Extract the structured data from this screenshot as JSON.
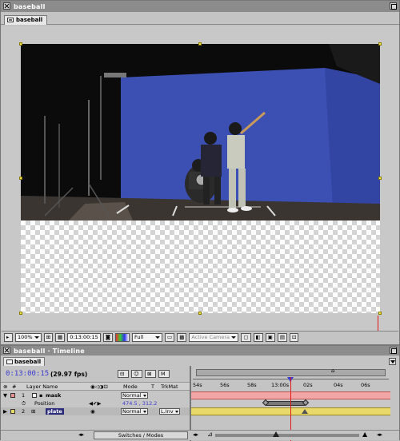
{
  "comp_window": {
    "title": "baseball",
    "tab_label": "baseball"
  },
  "comp_controls": {
    "zoom": "100%",
    "timecode": "0:13:00:15",
    "resolution": "Full",
    "view": "Active Camera"
  },
  "timeline_window": {
    "title": "baseball · Timeline",
    "tab_label": "baseball",
    "timecode": "0:13:00:15",
    "fps": "(29.97 fps)",
    "columns": {
      "layer_name": "Layer Name",
      "mode": "Mode",
      "t": "T",
      "trkmat": "TrkMat"
    },
    "layers": [
      {
        "number": "1",
        "name": "mask",
        "mode": "Normal",
        "color": "#e88e8e"
      },
      {
        "number": "2",
        "name": "plate",
        "mode": "Normal",
        "trkmat": "L.Inv",
        "color": "#e8d96a"
      }
    ],
    "position_property": {
      "label": "Position",
      "value": "474.5 , 312.2"
    },
    "ruler_ticks": [
      "54s",
      "56s",
      "58s",
      "13:00s",
      "02s",
      "04s",
      "06s"
    ],
    "switches_modes_label": "Switches / Modes"
  }
}
